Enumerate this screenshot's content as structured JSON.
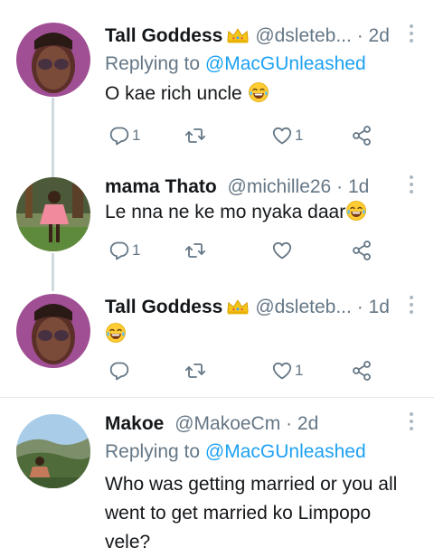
{
  "tweets": [
    {
      "name": "Tall Goddess",
      "handle": "@dsleteb...",
      "dot": "·",
      "time": "2d",
      "replying_label": "Replying to",
      "replying_to": "@MacGUnleashed",
      "text": "O kae rich uncle",
      "reply_count": "1",
      "retweet_count": "",
      "like_count": "1"
    },
    {
      "name": "mama Thato",
      "handle": "@michille26",
      "dot": "·",
      "time": "1d",
      "text": "Le nna ne ke mo nyaka daar",
      "reply_count": "1",
      "retweet_count": "",
      "like_count": ""
    },
    {
      "name": "Tall Goddess",
      "handle": "@dsleteb...",
      "dot": "·",
      "time": "1d",
      "text": "",
      "reply_count": "",
      "retweet_count": "",
      "like_count": "1"
    },
    {
      "name": "Makoe",
      "handle": "@MakoeCm",
      "dot": "·",
      "time": "2d",
      "replying_label": "Replying to",
      "replying_to": "@MacGUnleashed",
      "text": "Who was getting married or you all went to get married ko Limpopo vele?"
    }
  ],
  "icons": {
    "reply": "reply-icon",
    "retweet": "retweet-icon",
    "like": "heart-icon",
    "share": "share-icon",
    "crown": "crown-emoji",
    "laugh": "tears-of-joy-emoji",
    "menu": "more-vertical-icon"
  },
  "colors": {
    "link": "#1da1f2",
    "secondary": "#657786",
    "thread_line": "#cfd9de"
  }
}
